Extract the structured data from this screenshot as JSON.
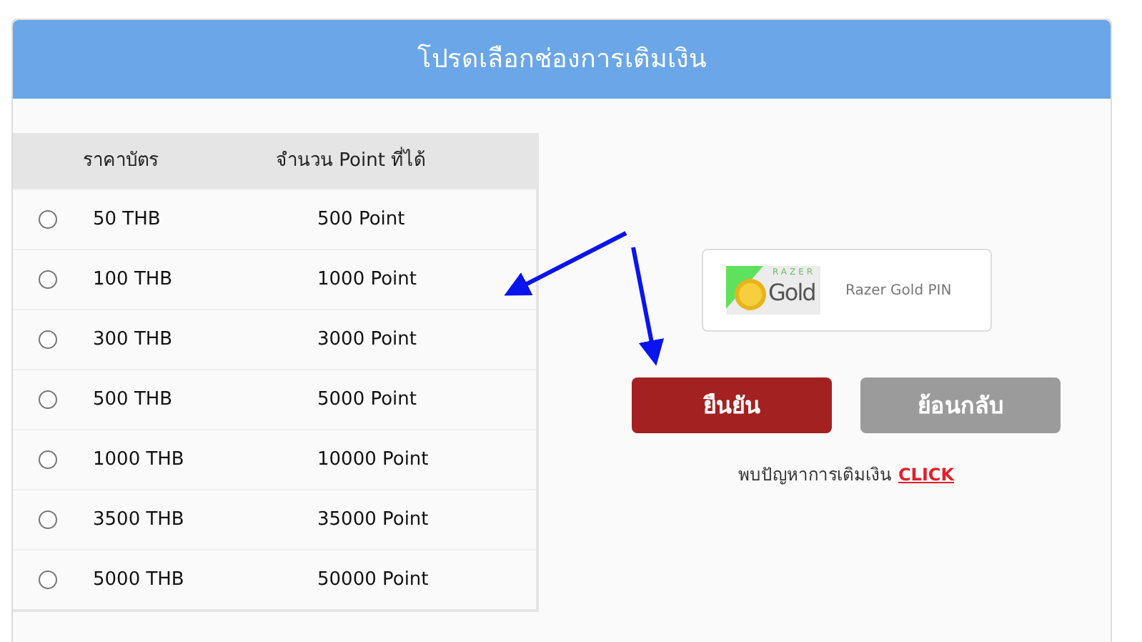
{
  "header": {
    "title": "โปรดเลือกช่องการเติมเงิน"
  },
  "table": {
    "columns": [
      "ราคาบัตร",
      "จำนวน Point ที่ได้"
    ],
    "rows": [
      {
        "price": "50 THB",
        "points": "500 Point",
        "selected": false
      },
      {
        "price": "100 THB",
        "points": "1000 Point",
        "selected": false
      },
      {
        "price": "300 THB",
        "points": "3000 Point",
        "selected": false
      },
      {
        "price": "500 THB",
        "points": "5000 Point",
        "selected": false
      },
      {
        "price": "1000 THB",
        "points": "10000 Point",
        "selected": false
      },
      {
        "price": "3500 THB",
        "points": "35000 Point",
        "selected": false
      },
      {
        "price": "5000 THB",
        "points": "50000 Point",
        "selected": false
      }
    ]
  },
  "payment_option": {
    "label": "Razer Gold PIN",
    "logo_small": "RAZER",
    "logo_large": "Gold"
  },
  "buttons": [
    {
      "label": "ยืนยัน",
      "kind": "primary"
    },
    {
      "label": "ย้อนกลับ",
      "kind": "secondary"
    }
  ],
  "help": {
    "text": "พบปัญหาการเติมเงิน",
    "link": "CLICK"
  }
}
